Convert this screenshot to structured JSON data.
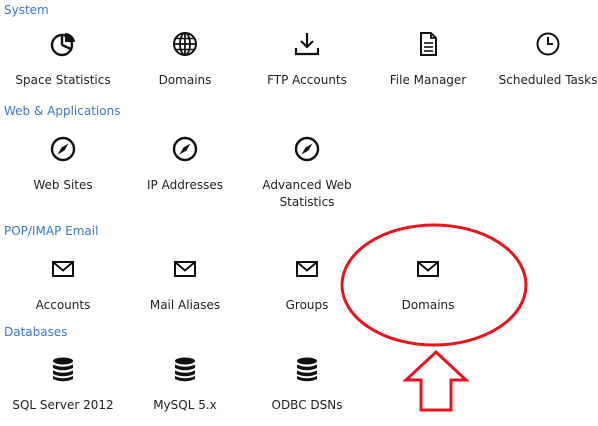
{
  "sections": {
    "system": {
      "title": "System",
      "items": [
        "Space Statistics",
        "Domains",
        "FTP Accounts",
        "File Manager",
        "Scheduled Tasks"
      ]
    },
    "web": {
      "title": "Web & Applications",
      "items": [
        "Web Sites",
        "IP Addresses",
        "Advanced Web Statistics"
      ]
    },
    "email": {
      "title": "POP/IMAP Email",
      "items": [
        "Accounts",
        "Mail Aliases",
        "Groups",
        "Domains"
      ]
    },
    "databases": {
      "title": "Databases",
      "items": [
        "SQL Server 2012",
        "MySQL 5.x",
        "ODBC DSNs"
      ]
    }
  },
  "annotation": {
    "circle_color": "#e8141c",
    "arrow_color": "#e8141c"
  },
  "icons": {
    "space-statistics": "pie-chart-icon",
    "domains": "globe-icon",
    "ftp": "download-icon",
    "file-manager": "document-icon",
    "scheduled-tasks": "clock-icon",
    "web": "compass-icon",
    "mail": "envelope-icon",
    "db": "database-icon"
  }
}
